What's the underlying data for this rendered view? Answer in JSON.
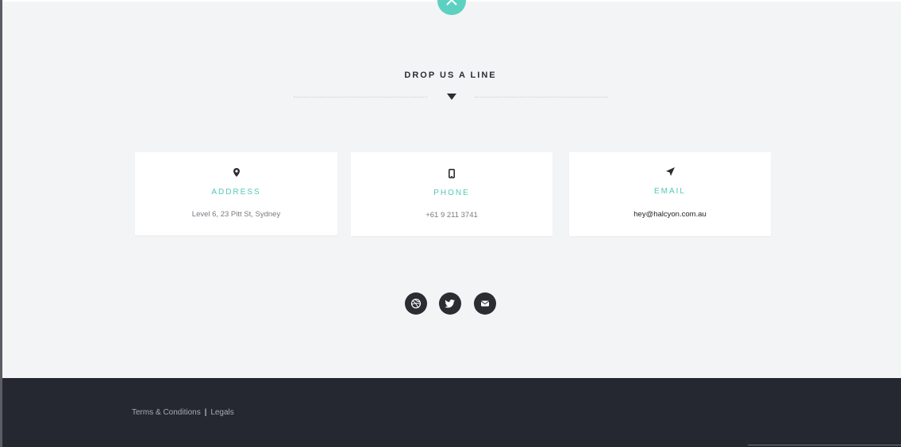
{
  "contact": {
    "title": "DROP US A LINE",
    "cards": [
      {
        "icon": "map-pin-icon",
        "label": "ADDRESS",
        "value": "Level 6, 23 Pitt St, Sydney"
      },
      {
        "icon": "mobile-phone-icon",
        "label": "PHONE",
        "value": "+61 9 211 3741"
      },
      {
        "icon": "paper-plane-icon",
        "label": "EMAIL",
        "value": "hey@halcyon.com.au"
      }
    ]
  },
  "social": [
    {
      "icon": "dribbble-icon"
    },
    {
      "icon": "twitter-icon"
    },
    {
      "icon": "envelope-icon"
    }
  ],
  "footer": {
    "links": [
      "Terms & Conditions",
      "Legals"
    ],
    "separator": "|"
  },
  "colors": {
    "accent": "#5cd1c1",
    "background": "#f3f4f6",
    "footer": "#252830",
    "dark": "#2b2d33"
  }
}
